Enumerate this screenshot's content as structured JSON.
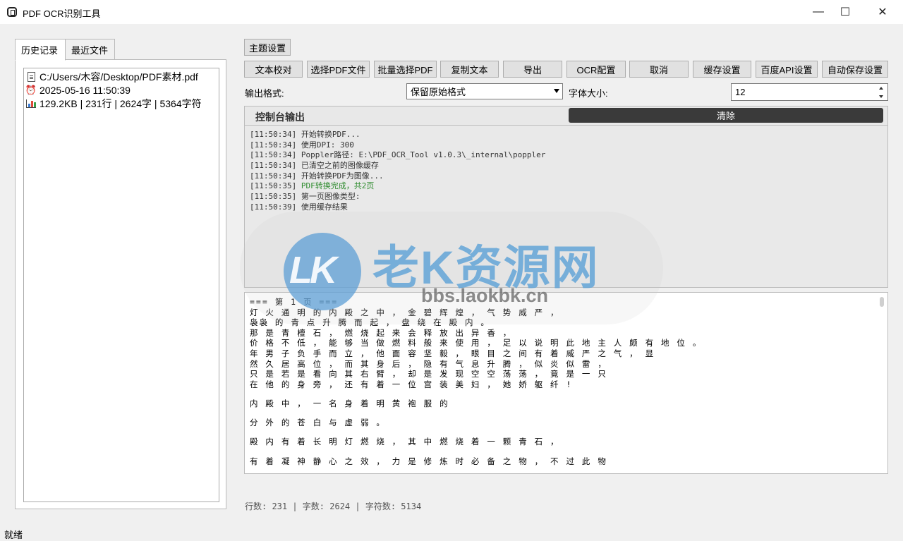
{
  "window": {
    "title": "PDF OCR识别工具",
    "app_icon": "app-icon",
    "controls": {
      "minimize": "—",
      "maximize": "☐",
      "close": "✕"
    }
  },
  "left_tabs": [
    {
      "label": "历史记录",
      "active": true
    },
    {
      "label": "最近文件",
      "active": false
    }
  ],
  "history": {
    "file_path": "C:/Users/木容/Desktop/PDF素材.pdf",
    "timestamp": "2025-05-16 11:50:39",
    "stats": "129.2KB | 231行 | 2624字 | 5364字符"
  },
  "toolbar": {
    "theme_button": "主题设置",
    "buttons": [
      "文本校对",
      "选择PDF文件",
      "批量选择PDF",
      "复制文本",
      "导出",
      "OCR配置",
      "取消",
      "缓存设置",
      "百度API设置",
      "自动保存设置"
    ]
  },
  "options": {
    "output_format_label": "输出格式:",
    "output_format_value": "保留原始格式",
    "font_size_label": "字体大小:",
    "font_size_value": "12"
  },
  "console": {
    "title": "控制台输出",
    "clear_button": "清除",
    "logs": [
      {
        "time": "[11:50:34]",
        "msg": "开始转换PDF...",
        "color": "#333333"
      },
      {
        "time": "[11:50:34]",
        "msg": "使用DPI: 300",
        "color": "#333333"
      },
      {
        "time": "[11:50:34]",
        "msg": "Poppler路径: E:\\PDF_OCR_Tool v1.0.3\\_internal\\poppler",
        "color": "#333333"
      },
      {
        "time": "[11:50:34]",
        "msg": "已清空之前的图像缓存",
        "color": "#333333"
      },
      {
        "time": "[11:50:34]",
        "msg": "开始转换PDF为图像...",
        "color": "#333333"
      },
      {
        "time": "[11:50:35]",
        "msg": "PDF转换完成，共2页",
        "color": "#2e8b2e"
      },
      {
        "time": "[11:50:35]",
        "msg": "第一页图像类型:",
        "color": "#333333"
      },
      {
        "time": "[11:50:39]",
        "msg": "使用缓存结果",
        "color": "#333333"
      }
    ]
  },
  "text_content": [
    "=== 第 1 页 ===",
    "灯 火 通 明 的 内 殿 之 中 ， 金 碧 辉 煌 ， 气 势 威 严 ，",
    "袅袅 的 青 点 升 腾 而 起 ， 盘 绕 在 殿 内 。",
    "那 是 青 檀 石 ， 燃 烧 起 来 会 释 放 出 异 香 ，",
    "价 格 不 低 ， 能 够 当 做 燃 料 般 来 使 用 ， 足 以 说 明 此 地 主 人 颇 有 地 位 。",
    "年 男 子 负 手 而 立 ， 他 面 容 坚 毅 ， 眼 目 之 间 有 着 威 严 之 气 ， 显",
    "然 久 居 高 位 ， 而 其 身 后 ， 隐 有 气 息 升 腾 ， 似 炎 似 雷 ，",
    "只 是 若 是 看 向 其 右 臂 ， 却 是 发 现 空 空 荡 荡 ， 竟 是 一 只",
    "在 他 的 身 旁 ， 还 有 着 一 位 宫 装 美 妇 ， 她 娇 躯 纤 !",
    "内 殿 中 ， 一 名 身 着 明 黄 袍 服 的",
    "分 外 的 苍 白 与 虚 弱 。",
    "殿 内 有 着 长 明 灯 燃 烧 ， 其 中 燃 烧 着 一 颗 青 石 ，",
    "有 着 凝 神 静 心 之 效 ， 力 是 修 炼 时 必 备 之 物 ， 不 过 此 物"
  ],
  "stats_bar": "行数: 231 | 字数: 2624 | 字符数: 5134",
  "status": "就绪",
  "watermark": {
    "logo": "LK",
    "text": "老K资源网",
    "url": "bbs.laokbk.cn"
  }
}
